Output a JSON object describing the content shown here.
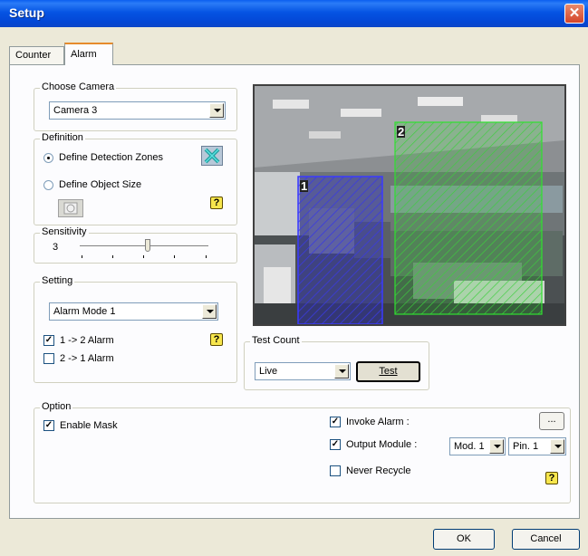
{
  "window": {
    "title": "Setup",
    "close_glyph": "✕"
  },
  "tabs": [
    {
      "label": "Counter"
    },
    {
      "label": "Alarm"
    }
  ],
  "choose_camera": {
    "label": "Choose Camera",
    "value": "Camera 3"
  },
  "definition": {
    "label": "Definition",
    "define_zones": "Define Detection Zones",
    "define_object": "Define Object Size",
    "selected": "define_zones",
    "help": "?"
  },
  "sensitivity": {
    "label": "Sensitivity",
    "value": "3",
    "level_fraction": 0.53
  },
  "setting": {
    "label": "Setting",
    "mode": "Alarm Mode 1",
    "alarm_1_2": {
      "label": "1 -> 2 Alarm",
      "checked": true
    },
    "alarm_2_1": {
      "label": "2 -> 1 Alarm",
      "checked": false
    },
    "help": "?"
  },
  "preview": {
    "zone1_label": "1",
    "zone2_label": "2",
    "zone1_color": "#2b2bd6",
    "zone2_color": "#28d028"
  },
  "test_count": {
    "label": "Test Count",
    "value": "Live",
    "test_button": "Test"
  },
  "option": {
    "label": "Option",
    "enable_mask": {
      "label": "Enable Mask",
      "checked": true
    },
    "invoke_alarm": {
      "label": "Invoke Alarm :",
      "checked": true,
      "browse": "..."
    },
    "output_module": {
      "label": "Output Module :",
      "checked": true,
      "module": "Mod. 1",
      "pin": "Pin. 1"
    },
    "never_recycle": {
      "label": "Never Recycle",
      "checked": false
    },
    "help": "?"
  },
  "buttons": {
    "ok": "OK",
    "cancel": "Cancel"
  }
}
